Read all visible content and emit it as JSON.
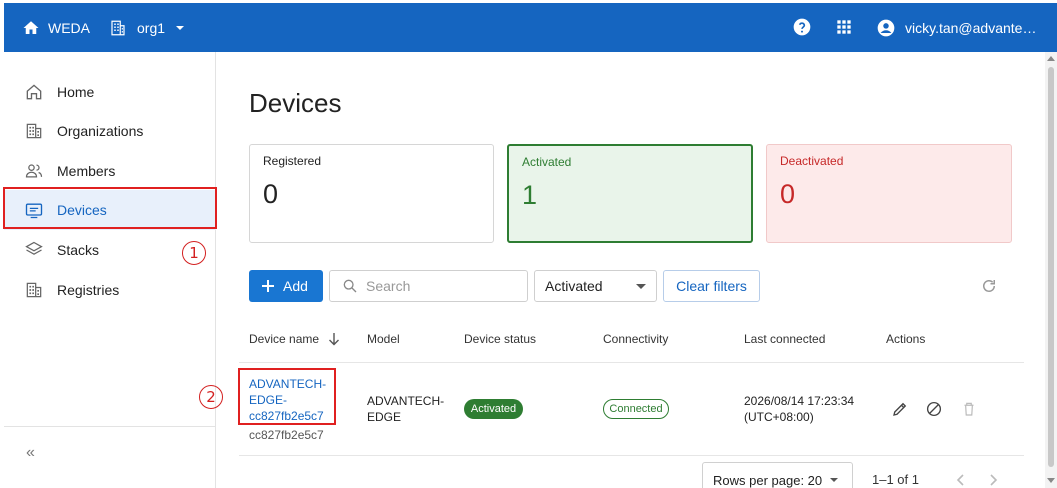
{
  "topbar": {
    "app_name": "WEDA",
    "org_name": "org1",
    "user": "vicky.tan@advantech.com",
    "icons": [
      "home-icon",
      "building-icon",
      "caret-down-icon",
      "help-icon",
      "apps-grid-icon",
      "account-icon"
    ]
  },
  "sidebar": {
    "items": [
      {
        "label": "Home",
        "icon": "home-icon"
      },
      {
        "label": "Organizations",
        "icon": "building-icon"
      },
      {
        "label": "Members",
        "icon": "members-icon"
      },
      {
        "label": "Devices",
        "icon": "device-icon",
        "active": true
      },
      {
        "label": "Stacks",
        "icon": "layers-icon"
      },
      {
        "label": "Registries",
        "icon": "building-icon"
      }
    ],
    "collapse_label": "«"
  },
  "annotations": {
    "step1": "1",
    "step2": "2"
  },
  "page": {
    "title": "Devices"
  },
  "stats": {
    "registered": {
      "label": "Registered",
      "value": "0"
    },
    "activated": {
      "label": "Activated",
      "value": "1"
    },
    "deactivated": {
      "label": "Deactivated",
      "value": "0"
    }
  },
  "toolbar": {
    "add_label": "Add",
    "search_placeholder": "Search",
    "status_filter": "Activated",
    "clear_label": "Clear filters"
  },
  "table": {
    "headers": [
      "Device name",
      "Model",
      "Device status",
      "Connectivity",
      "Last connected",
      "Actions"
    ],
    "rows": [
      {
        "device_name": "ADVANTECH-EDGE-cc827fb2e5c7",
        "device_id": "cc827fb2e5c7",
        "model": "ADVANTECH-EDGE",
        "status": "Activated",
        "connectivity": "Connected",
        "last_connected": "2026/08/14 17:23:34 (UTC+08:00)"
      }
    ]
  },
  "pagination": {
    "rows_per_page": "Rows per page: 20",
    "range": "1–1 of 1"
  },
  "colors": {
    "primary": "#1565c0",
    "success": "#2e7d32",
    "danger": "#c62828",
    "highlight": "#e02020"
  }
}
